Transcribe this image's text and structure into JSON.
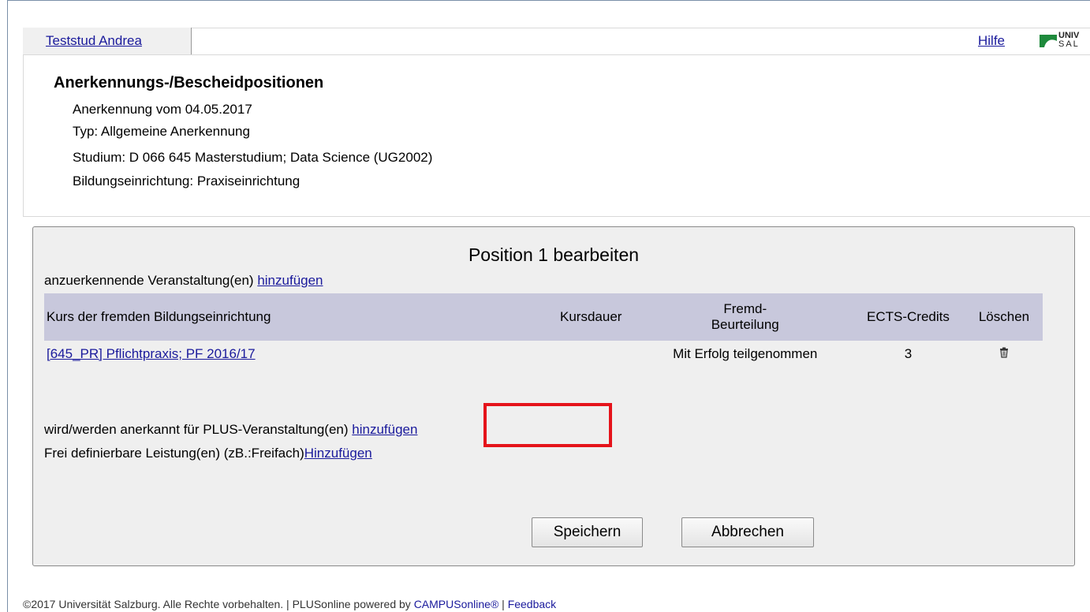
{
  "header": {
    "user_name": "Teststud Andrea",
    "help_label": "Hilfe",
    "logo_text_line1": "UNIV",
    "logo_text_line2": "SAL"
  },
  "page": {
    "title": "Anerkennungs-/Bescheidpositionen",
    "recognition_date": "Anerkennung vom 04.05.2017",
    "type": "Typ: Allgemeine Anerkennung",
    "study": "Studium: D 066 645 Masterstudium; Data Science (UG2002)",
    "institution": "Bildungseinrichtung: Praxiseinrichtung"
  },
  "panel": {
    "title": "Position 1 bearbeiten",
    "courses_label": "anzuerkennende Veranstaltung(en)",
    "courses_add_link": "hinzufügen",
    "table": {
      "columns": [
        "Kurs der fremden Bildungseinrichtung",
        "Kursdauer",
        "Fremd-\nBeurteilung",
        "ECTS-Credits",
        "Löschen"
      ],
      "rows": [
        {
          "course": "[645_PR] Pflichtpraxis; PF 2016/17",
          "duration": "",
          "grade": "Mit Erfolg teilgenommen",
          "ects": "3",
          "delete_icon": "trash-icon"
        }
      ]
    },
    "plus_label": "wird/werden anerkannt für PLUS-Veranstaltung(en)",
    "plus_add_link": "hinzufügen",
    "free_label": "Frei definierbare Leistung(en) (zB.:Freifach)",
    "free_add_link": "Hinzufügen",
    "save_label": "Speichern",
    "cancel_label": "Abbrechen",
    "highlight_color": "#e5131b"
  },
  "footer": {
    "copyright": "©2017 Universität Salzburg. Alle Rechte vorbehalten. | PLUSonline powered by ",
    "campus_link": "CAMPUSonline®",
    "separator": " | ",
    "feedback_link": "Feedback"
  }
}
